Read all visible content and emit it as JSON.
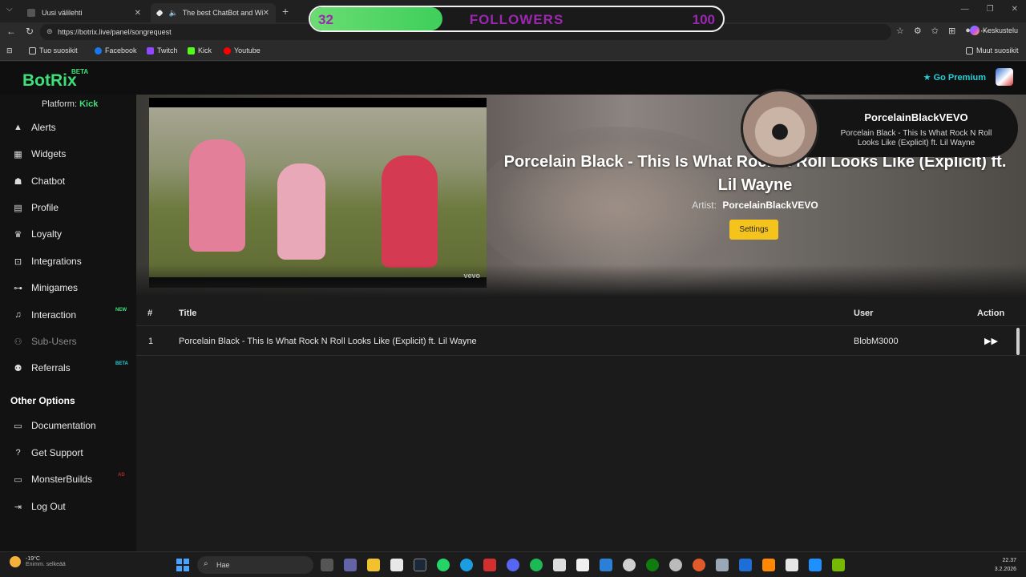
{
  "browser": {
    "tabs": [
      {
        "label": "Uusi välilehti",
        "active": false
      },
      {
        "label": "The best ChatBot and Widget",
        "active": true
      }
    ],
    "url": "https://botrix.live/panel/songrequest",
    "bookmarks": [
      {
        "label": "Tuo suosikit",
        "icon": "folder-icon"
      },
      {
        "label": "Facebook",
        "icon": "facebook-icon"
      },
      {
        "label": "Twitch",
        "icon": "twitch-icon"
      },
      {
        "label": "Kick",
        "icon": "kick-icon"
      },
      {
        "label": "Youtube",
        "icon": "youtube-icon"
      }
    ],
    "other_favorites": "Muut suosikit",
    "copilot_label": "Keskustelu"
  },
  "followers_overlay": {
    "current": "32",
    "label": "FOLLOWERS",
    "goal": "100",
    "progress": 0.32,
    "label_color": "#9c27b0",
    "bar_color": "#3ecf5a"
  },
  "header": {
    "logo": "BotRix",
    "logo_badge": "BETA",
    "premium": "Go Premium",
    "brand_color": "#3ee07a",
    "premium_color": "#25d0d6"
  },
  "sidebar": {
    "platform_label": "Platform:",
    "platform_value": "Kick",
    "items": [
      {
        "label": "Alerts",
        "icon": "warning-icon"
      },
      {
        "label": "Widgets",
        "icon": "grid-icon"
      },
      {
        "label": "Chatbot",
        "icon": "robot-icon"
      },
      {
        "label": "Profile",
        "icon": "id-card-icon"
      },
      {
        "label": "Loyalty",
        "icon": "trophy-icon"
      },
      {
        "label": "Integrations",
        "icon": "plug-icon"
      },
      {
        "label": "Minigames",
        "icon": "gamepad-icon"
      },
      {
        "label": "Interaction",
        "icon": "music-icon",
        "badge": "NEW"
      },
      {
        "label": "Sub-Users",
        "icon": "users-icon"
      },
      {
        "label": "Referrals",
        "icon": "user-group-icon",
        "badge": "BETA"
      }
    ],
    "other_options_title": "Other Options",
    "other_items": [
      {
        "label": "Documentation",
        "icon": "book-icon"
      },
      {
        "label": "Get Support",
        "icon": "question-icon"
      },
      {
        "label": "MonsterBuilds",
        "icon": "laptop-icon",
        "badge": "AD"
      },
      {
        "label": "Log Out",
        "icon": "logout-icon"
      }
    ]
  },
  "now_playing": {
    "title": "Porcelain Black - This Is What Rock N Roll Looks Like (Explicit) ft. Lil Wayne",
    "artist_label": "Artist:",
    "artist": "PorcelainBlackVEVO",
    "settings_label": "Settings",
    "video_watermark": "vevo"
  },
  "channel_overlay": {
    "name": "PorcelainBlackVEVO",
    "description": "Porcelain Black - This Is What Rock N Roll Looks Like (Explicit) ft. Lil Wayne"
  },
  "queue": {
    "columns": [
      "#",
      "Title",
      "User",
      "Action"
    ],
    "rows": [
      {
        "num": "1",
        "title": "Porcelain Black - This Is What Rock N Roll Looks Like (Explicit) ft. Lil Wayne",
        "user": "BlobM3000",
        "action_icon": "fast-forward-icon"
      }
    ]
  },
  "taskbar": {
    "temp": "-19°C",
    "weather": "Enimm. selkeää",
    "search_placeholder": "Hae",
    "time": "22.37",
    "date": "3.2.2026"
  }
}
